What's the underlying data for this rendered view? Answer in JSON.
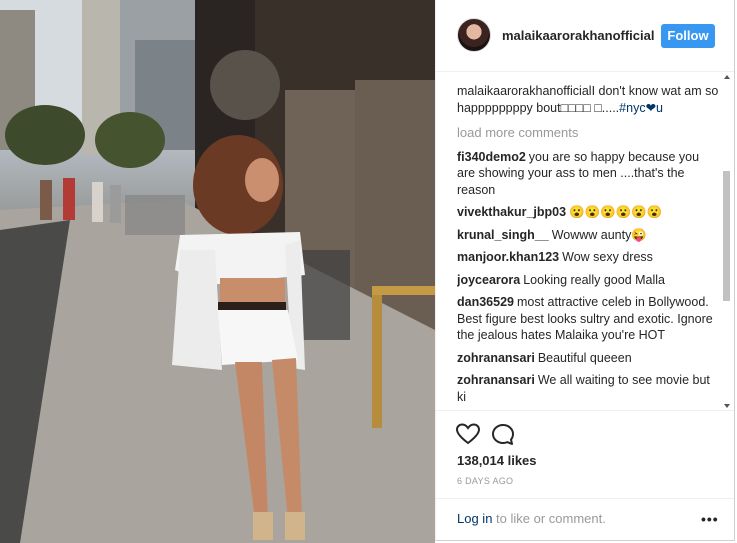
{
  "post": {
    "username": "malaikaarorakhanofficial",
    "follow_label": "Follow",
    "caption_user": "malaikaarorakhanofficial",
    "caption_text": "I don't know wat am so happppppppy bout□□□□ □.....",
    "caption_tags": "#nyc❤u",
    "load_more": "load more comments",
    "comments": [
      {
        "user": "fi340demo2",
        "text": "you are so happy because you are showing your ass to men ....that's the reason"
      },
      {
        "user": "vivekthakur_jbp03",
        "text": "😮😮😮😮😮😮"
      },
      {
        "user": "krunal_singh__",
        "text": "Wowww aunty😜"
      },
      {
        "user": "manjoor.khan123",
        "text": "Wow sexy dress"
      },
      {
        "user": "joycearora",
        "text": "Looking really good Malla"
      },
      {
        "user": "dan36529",
        "text": "most attractive celeb in Bollywood. Best figure best looks sultry and exotic. Ignore the jealous hates Malaika you're HOT"
      },
      {
        "user": "zohranansari",
        "text": "Beautiful queeen"
      },
      {
        "user": "zohranansari",
        "text": "We all waiting to see movie but ki"
      }
    ],
    "likes": "138,014 likes",
    "time_ago": "6 DAYS AGO",
    "login_link": "Log in",
    "login_rest": " to like or comment.",
    "more_label": "•••"
  },
  "icons": {
    "like": "heart-outline-icon",
    "comment": "speech-bubble-icon",
    "more": "ellipsis-icon"
  },
  "colors": {
    "accent": "#3897f0",
    "link": "#003569",
    "muted": "#999999",
    "text": "#262626"
  }
}
